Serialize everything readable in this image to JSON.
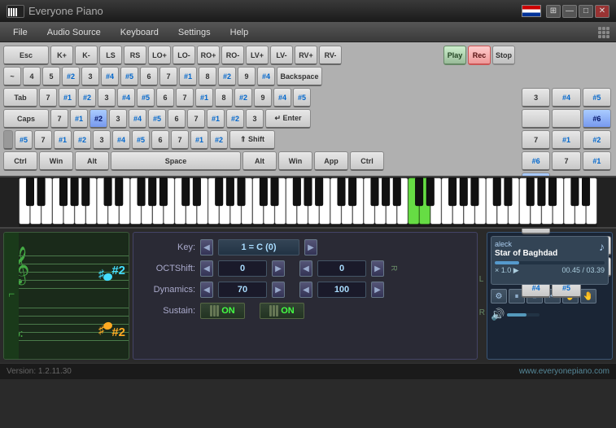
{
  "app": {
    "title": "Everyone Piano",
    "version": "Version: 1.2.11.30",
    "website": "www.everyonepiano.com"
  },
  "titlebar": {
    "close_label": "✕",
    "minimize_label": "—",
    "maximize_label": "□",
    "menu_label": "⊞"
  },
  "menu": {
    "items": [
      "File",
      "Audio Source",
      "Keyboard",
      "Settings",
      "Help"
    ]
  },
  "keyboard_buttons": {
    "row1_special": [
      "Esc"
    ],
    "row1_fn": [
      "K+",
      "K-",
      "LS",
      "RS",
      "LO+",
      "LO-",
      "RO+",
      "RO-",
      "LV+",
      "LV-",
      "RV+",
      "RV-"
    ],
    "play": "Play",
    "rec": "Rec",
    "stop": "Stop"
  },
  "controls": {
    "key_label": "Key:",
    "key_value": "1 = C (0)",
    "octshift_label": "OCTShift:",
    "octshift_left": "0",
    "octshift_right": "0",
    "dynamics_label": "Dynamics:",
    "dynamics_left": "70",
    "dynamics_right": "100",
    "sustain_label": "Sustain:",
    "sustain_on": "ON"
  },
  "player": {
    "artist": "aleck",
    "song": "Star of Baghdad",
    "time_current": "00.45",
    "time_total": "03.39",
    "speed": "× 1.0"
  },
  "piano_keys": {
    "green_positions": [
      35,
      36
    ],
    "blue_positions": [
      52
    ]
  }
}
